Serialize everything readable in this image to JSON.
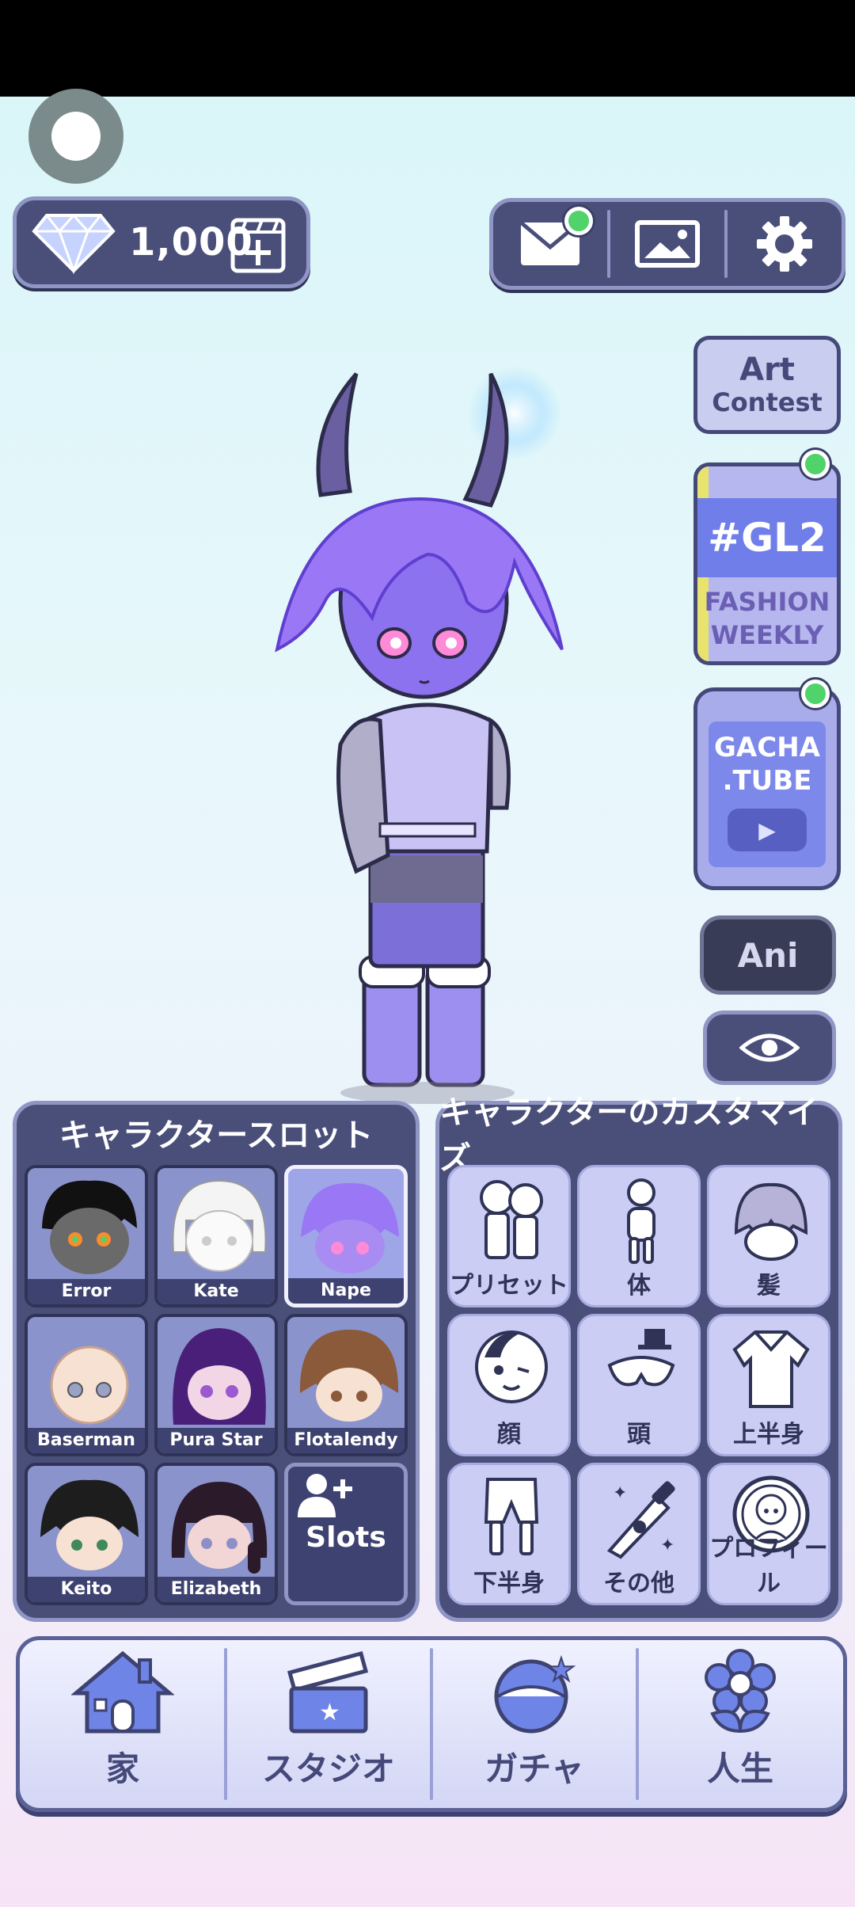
{
  "currency": {
    "amount": "1,000"
  },
  "side": {
    "art_contest": {
      "line1": "Art",
      "line2": "Contest"
    },
    "gl2": {
      "tag": "#GL2",
      "line1": "FASHION",
      "line2": "WEEKLY"
    },
    "gacha_tube": {
      "line1": "GACHA",
      "line2": ".TUBE"
    },
    "ani_label": "Ani"
  },
  "slots": {
    "title": "キャラクタースロット",
    "items": [
      {
        "label": "Error"
      },
      {
        "label": "Kate"
      },
      {
        "label": "Nape"
      },
      {
        "label": "Baserman"
      },
      {
        "label": "Pura Star"
      },
      {
        "label": "Flotalendy"
      },
      {
        "label": "Keito"
      },
      {
        "label": "Elizabeth"
      }
    ],
    "add_label": "Slots"
  },
  "customize": {
    "title": "キャラクターのカスタマイズ",
    "items": [
      {
        "label": "プリセット"
      },
      {
        "label": "体"
      },
      {
        "label": "髪"
      },
      {
        "label": "顔"
      },
      {
        "label": "頭"
      },
      {
        "label": "上半身"
      },
      {
        "label": "下半身"
      },
      {
        "label": "その他"
      },
      {
        "label": "プロフィール"
      }
    ]
  },
  "nav": {
    "items": [
      {
        "label": "家",
        "icon": "house-icon"
      },
      {
        "label": "スタジオ",
        "icon": "clapperboard-icon"
      },
      {
        "label": "ガチャ",
        "icon": "gacha-ball-icon"
      },
      {
        "label": "人生",
        "icon": "flower-icon"
      }
    ]
  }
}
